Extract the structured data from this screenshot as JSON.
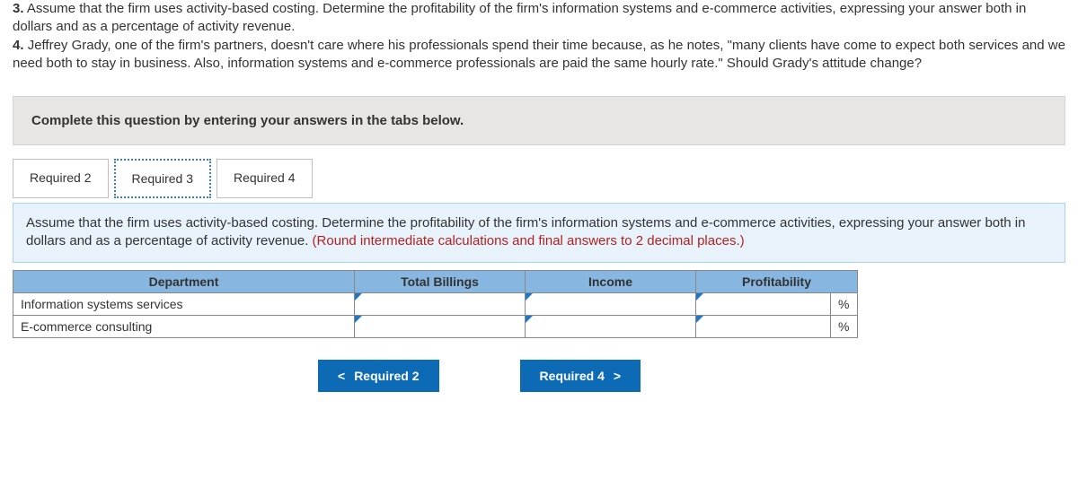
{
  "questions": {
    "q3_number": "3.",
    "q3_text": "Assume that the firm uses activity-based costing. Determine the profitability of the firm's information systems and e-commerce activities, expressing your answer both in dollars and as a percentage of activity revenue.",
    "q4_number": "4.",
    "q4_text": "Jeffrey Grady, one of the firm's partners, doesn't care where his professionals spend their time because, as he notes, \"many clients have come to expect both services and we need both to stay in business. Also, information systems and e-commerce professionals are paid the same hourly rate.\" Should Grady's attitude change?"
  },
  "instruction": "Complete this question by entering your answers in the tabs below.",
  "tabs": {
    "required2": "Required 2",
    "required3": "Required 3",
    "required4": "Required 4"
  },
  "panel": {
    "prompt": "Assume that the firm uses activity-based costing. Determine the profitability of the firm's information systems and e-commerce activities, expressing your answer both in dollars and as a percentage of activity revenue.",
    "hint": "(Round intermediate calculations and final answers to 2 decimal places.)"
  },
  "table": {
    "headers": {
      "department": "Department",
      "billings": "Total Billings",
      "income": "Income",
      "profitability": "Profitability"
    },
    "rows": [
      {
        "department": "Information systems services",
        "billings": "",
        "income": "",
        "profitability": "",
        "unit": "%"
      },
      {
        "department": "E-commerce consulting",
        "billings": "",
        "income": "",
        "profitability": "",
        "unit": "%"
      }
    ]
  },
  "nav": {
    "prev_chev": "<",
    "prev": "Required 2",
    "next": "Required 4",
    "next_chev": ">"
  }
}
